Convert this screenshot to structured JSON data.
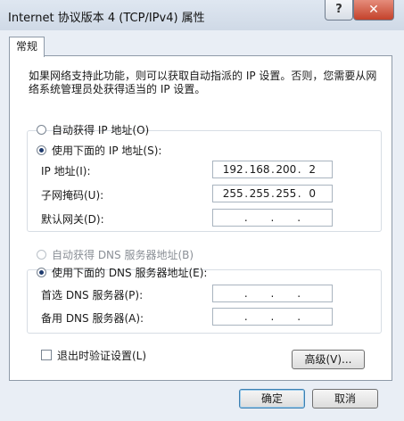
{
  "window": {
    "title": "Internet 协议版本 4 (TCP/IPv4) 属性"
  },
  "tabs": [
    {
      "label": "常规"
    }
  ],
  "description": "如果网络支持此功能，则可以获取自动指派的 IP 设置。否则，您需要从网络系统管理员处获得适当的 IP 设置。",
  "ip": {
    "auto_label": "自动获得 IP 地址(O)",
    "manual_label": "使用下面的 IP 地址(S):",
    "selected": "manual",
    "fields": [
      {
        "label": "IP 地址(I):",
        "octets": [
          "192",
          "168",
          "200",
          "2"
        ]
      },
      {
        "label": "子网掩码(U):",
        "octets": [
          "255",
          "255",
          "255",
          "0"
        ]
      },
      {
        "label": "默认网关(D):",
        "octets": [
          "",
          "",
          "",
          ""
        ]
      }
    ]
  },
  "dns": {
    "auto_label": "自动获得 DNS 服务器地址(B)",
    "manual_label": "使用下面的 DNS 服务器地址(E):",
    "selected": "manual",
    "fields": [
      {
        "label": "首选 DNS 服务器(P):",
        "octets": [
          "",
          "",
          "",
          ""
        ]
      },
      {
        "label": "备用 DNS 服务器(A):",
        "octets": [
          "",
          "",
          "",
          ""
        ]
      }
    ]
  },
  "validate_on_exit": {
    "label": "退出时验证设置(L)",
    "checked": false
  },
  "buttons": {
    "advanced": "高级(V)...",
    "ok": "确定",
    "cancel": "取消"
  }
}
